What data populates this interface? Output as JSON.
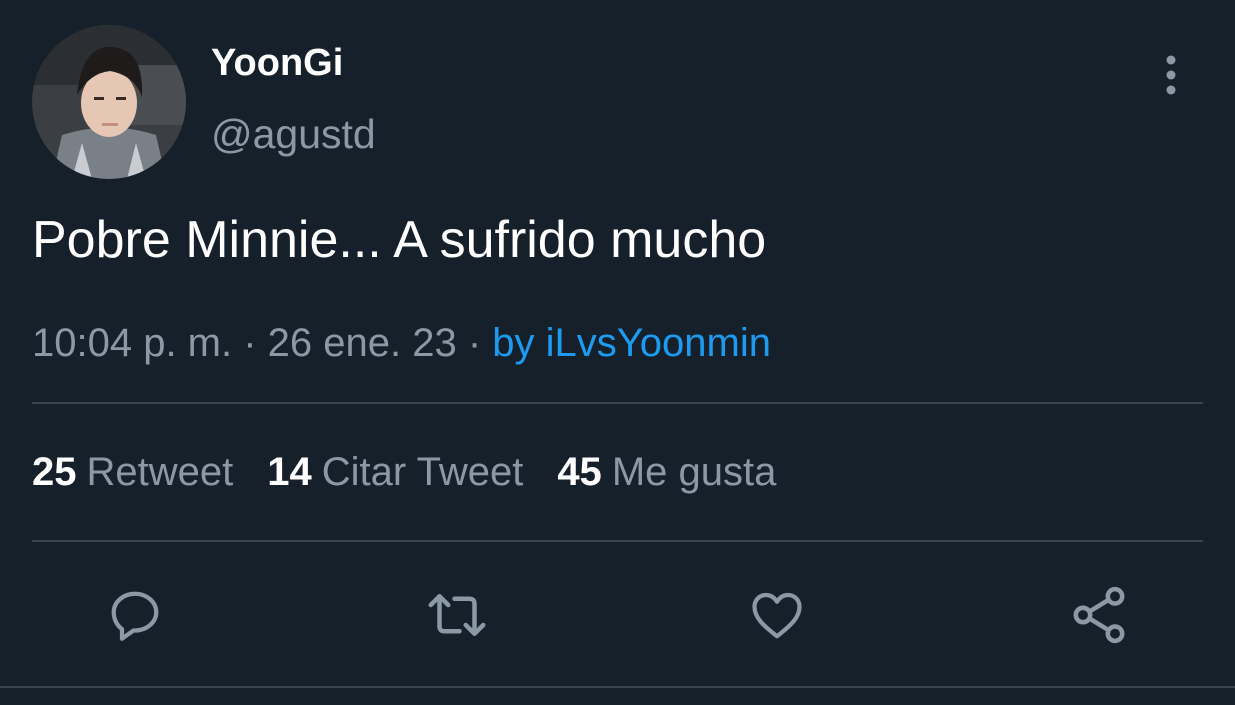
{
  "author": {
    "display_name": "YoonGi",
    "handle": "@agustd"
  },
  "tweet": {
    "text": "Pobre Minnie... A sufrido mucho"
  },
  "meta": {
    "time": "10:04 p. m.",
    "separator": " · ",
    "date": "26 ene. 23",
    "via": "by iLvsYoonmin"
  },
  "stats": {
    "retweets": {
      "count": "25",
      "label": "Retweet"
    },
    "quotes": {
      "count": "14",
      "label": "Citar Tweet"
    },
    "likes": {
      "count": "45",
      "label": "Me gusta"
    }
  },
  "icons": {
    "reply": "reply-icon",
    "retweet": "retweet-icon",
    "like": "heart-icon",
    "share": "share-icon",
    "more": "more-vertical-icon"
  },
  "colors": {
    "background": "#15202b",
    "text_primary": "#ffffff",
    "text_secondary": "#8b98a5",
    "accent": "#1d9bf0",
    "divider": "#38444d"
  }
}
